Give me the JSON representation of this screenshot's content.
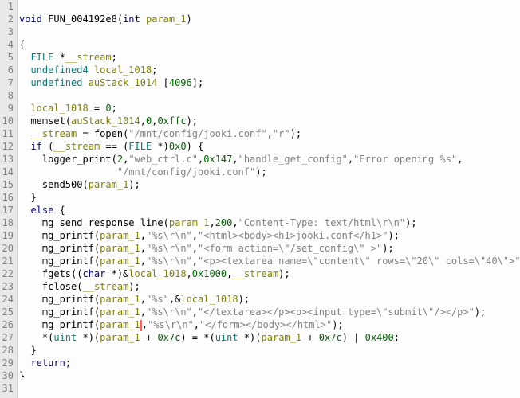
{
  "lines": [
    {
      "n": 1,
      "t": ""
    },
    {
      "n": 2,
      "t": "void FUN_004192e8(int param_1)",
      "seg": [
        {
          "c": "kw",
          "v": "void "
        },
        {
          "c": "fn",
          "v": "FUN_004192e8"
        },
        {
          "c": "",
          "v": "("
        },
        {
          "c": "kw",
          "v": "int "
        },
        {
          "c": "id",
          "v": "param_1"
        },
        {
          "c": "",
          "v": ")"
        }
      ]
    },
    {
      "n": 3,
      "t": ""
    },
    {
      "n": 4,
      "t": "{"
    },
    {
      "n": 5,
      "seg": [
        {
          "c": "",
          "v": "  "
        },
        {
          "c": "ty",
          "v": "FILE "
        },
        {
          "c": "",
          "v": "*"
        },
        {
          "c": "id",
          "v": "__stream"
        },
        {
          "c": "",
          "v": ";"
        }
      ]
    },
    {
      "n": 6,
      "seg": [
        {
          "c": "",
          "v": "  "
        },
        {
          "c": "ty",
          "v": "undefined4 "
        },
        {
          "c": "id",
          "v": "local_1018"
        },
        {
          "c": "",
          "v": ";"
        }
      ]
    },
    {
      "n": 7,
      "seg": [
        {
          "c": "",
          "v": "  "
        },
        {
          "c": "ty",
          "v": "undefined "
        },
        {
          "c": "id",
          "v": "auStack_1014 "
        },
        {
          "c": "",
          "v": "["
        },
        {
          "c": "num",
          "v": "4096"
        },
        {
          "c": "",
          "v": "];"
        }
      ]
    },
    {
      "n": 8,
      "t": "  "
    },
    {
      "n": 9,
      "seg": [
        {
          "c": "",
          "v": "  "
        },
        {
          "c": "id",
          "v": "local_1018"
        },
        {
          "c": "",
          "v": " = "
        },
        {
          "c": "num",
          "v": "0"
        },
        {
          "c": "",
          "v": ";"
        }
      ]
    },
    {
      "n": 10,
      "seg": [
        {
          "c": "",
          "v": "  "
        },
        {
          "c": "fn",
          "v": "memset"
        },
        {
          "c": "",
          "v": "("
        },
        {
          "c": "id",
          "v": "auStack_1014"
        },
        {
          "c": "",
          "v": ","
        },
        {
          "c": "num",
          "v": "0"
        },
        {
          "c": "",
          "v": ","
        },
        {
          "c": "num",
          "v": "0xffc"
        },
        {
          "c": "",
          "v": ");"
        }
      ]
    },
    {
      "n": 11,
      "seg": [
        {
          "c": "",
          "v": "  "
        },
        {
          "c": "id",
          "v": "__stream"
        },
        {
          "c": "",
          "v": " = "
        },
        {
          "c": "fn",
          "v": "fopen"
        },
        {
          "c": "",
          "v": "("
        },
        {
          "c": "str",
          "v": "\"/mnt/config/jooki.conf\""
        },
        {
          "c": "",
          "v": ","
        },
        {
          "c": "str",
          "v": "\"r\""
        },
        {
          "c": "",
          "v": ");"
        }
      ]
    },
    {
      "n": 12,
      "seg": [
        {
          "c": "",
          "v": "  "
        },
        {
          "c": "kw",
          "v": "if "
        },
        {
          "c": "",
          "v": "("
        },
        {
          "c": "id",
          "v": "__stream"
        },
        {
          "c": "",
          "v": " == ("
        },
        {
          "c": "ty",
          "v": "FILE "
        },
        {
          "c": "",
          "v": "*)"
        },
        {
          "c": "num",
          "v": "0x0"
        },
        {
          "c": "",
          "v": ") {"
        }
      ]
    },
    {
      "n": 13,
      "seg": [
        {
          "c": "",
          "v": "    "
        },
        {
          "c": "fn",
          "v": "logger_print"
        },
        {
          "c": "",
          "v": "("
        },
        {
          "c": "num",
          "v": "2"
        },
        {
          "c": "",
          "v": ","
        },
        {
          "c": "str",
          "v": "\"web_ctrl.c\""
        },
        {
          "c": "",
          "v": ","
        },
        {
          "c": "num",
          "v": "0x147"
        },
        {
          "c": "",
          "v": ","
        },
        {
          "c": "str",
          "v": "\"handle_get_config\""
        },
        {
          "c": "",
          "v": ","
        },
        {
          "c": "str",
          "v": "\"Error opening %s\""
        },
        {
          "c": "",
          "v": ","
        }
      ]
    },
    {
      "n": 14,
      "seg": [
        {
          "c": "",
          "v": "                 "
        },
        {
          "c": "str",
          "v": "\"/mnt/config/jooki.conf\""
        },
        {
          "c": "",
          "v": ");"
        }
      ]
    },
    {
      "n": 15,
      "seg": [
        {
          "c": "",
          "v": "    "
        },
        {
          "c": "fn",
          "v": "send500"
        },
        {
          "c": "",
          "v": "("
        },
        {
          "c": "id",
          "v": "param_1"
        },
        {
          "c": "",
          "v": ");"
        }
      ]
    },
    {
      "n": 16,
      "t": "  }"
    },
    {
      "n": 17,
      "seg": [
        {
          "c": "",
          "v": "  "
        },
        {
          "c": "kw",
          "v": "else "
        },
        {
          "c": "",
          "v": "{"
        }
      ]
    },
    {
      "n": 18,
      "seg": [
        {
          "c": "",
          "v": "    "
        },
        {
          "c": "fn",
          "v": "mg_send_response_line"
        },
        {
          "c": "",
          "v": "("
        },
        {
          "c": "id",
          "v": "param_1"
        },
        {
          "c": "",
          "v": ","
        },
        {
          "c": "num",
          "v": "200"
        },
        {
          "c": "",
          "v": ","
        },
        {
          "c": "str",
          "v": "\"Content-Type: text/html\\r\\n\""
        },
        {
          "c": "",
          "v": ");"
        }
      ]
    },
    {
      "n": 19,
      "seg": [
        {
          "c": "",
          "v": "    "
        },
        {
          "c": "fn",
          "v": "mg_printf"
        },
        {
          "c": "",
          "v": "("
        },
        {
          "c": "id",
          "v": "param_1"
        },
        {
          "c": "",
          "v": ","
        },
        {
          "c": "str",
          "v": "\"%s\\r\\n\""
        },
        {
          "c": "",
          "v": ","
        },
        {
          "c": "str",
          "v": "\"<html><body><h1>jooki.conf</h1>\""
        },
        {
          "c": "",
          "v": ");"
        }
      ]
    },
    {
      "n": 20,
      "seg": [
        {
          "c": "",
          "v": "    "
        },
        {
          "c": "fn",
          "v": "mg_printf"
        },
        {
          "c": "",
          "v": "("
        },
        {
          "c": "id",
          "v": "param_1"
        },
        {
          "c": "",
          "v": ","
        },
        {
          "c": "str",
          "v": "\"%s\\r\\n\""
        },
        {
          "c": "",
          "v": ","
        },
        {
          "c": "str",
          "v": "\"<form action=\\\"/set_config\\\" >\""
        },
        {
          "c": "",
          "v": ");"
        }
      ]
    },
    {
      "n": 21,
      "seg": [
        {
          "c": "",
          "v": "    "
        },
        {
          "c": "fn",
          "v": "mg_printf"
        },
        {
          "c": "",
          "v": "("
        },
        {
          "c": "id",
          "v": "param_1"
        },
        {
          "c": "",
          "v": ","
        },
        {
          "c": "str",
          "v": "\"%s\\r\\n\""
        },
        {
          "c": "",
          "v": ","
        },
        {
          "c": "str",
          "v": "\"<p><textarea name=\\\"content\\\" rows=\\\"20\\\" cols=\\\"40\\\">\""
        },
        {
          "c": "",
          "v": ");"
        }
      ]
    },
    {
      "n": 22,
      "seg": [
        {
          "c": "",
          "v": "    "
        },
        {
          "c": "fn",
          "v": "fgets"
        },
        {
          "c": "",
          "v": "(("
        },
        {
          "c": "kw",
          "v": "char "
        },
        {
          "c": "",
          "v": "*)&"
        },
        {
          "c": "id",
          "v": "local_1018"
        },
        {
          "c": "",
          "v": ","
        },
        {
          "c": "num",
          "v": "0x1000"
        },
        {
          "c": "",
          "v": ","
        },
        {
          "c": "id",
          "v": "__stream"
        },
        {
          "c": "",
          "v": ");"
        }
      ]
    },
    {
      "n": 23,
      "seg": [
        {
          "c": "",
          "v": "    "
        },
        {
          "c": "fn",
          "v": "fclose"
        },
        {
          "c": "",
          "v": "("
        },
        {
          "c": "id",
          "v": "__stream"
        },
        {
          "c": "",
          "v": ");"
        }
      ]
    },
    {
      "n": 24,
      "seg": [
        {
          "c": "",
          "v": "    "
        },
        {
          "c": "fn",
          "v": "mg_printf"
        },
        {
          "c": "",
          "v": "("
        },
        {
          "c": "id",
          "v": "param_1"
        },
        {
          "c": "",
          "v": ","
        },
        {
          "c": "str",
          "v": "\"%s\""
        },
        {
          "c": "",
          "v": ",&"
        },
        {
          "c": "id",
          "v": "local_1018"
        },
        {
          "c": "",
          "v": ");"
        }
      ]
    },
    {
      "n": 25,
      "seg": [
        {
          "c": "",
          "v": "    "
        },
        {
          "c": "fn",
          "v": "mg_printf"
        },
        {
          "c": "",
          "v": "("
        },
        {
          "c": "id",
          "v": "param_1"
        },
        {
          "c": "",
          "v": ","
        },
        {
          "c": "str",
          "v": "\"%s\\r\\n\""
        },
        {
          "c": "",
          "v": ","
        },
        {
          "c": "str",
          "v": "\"</textarea></p><p><input type=\\\"submit\\\"/></p>\""
        },
        {
          "c": "",
          "v": ");"
        }
      ]
    },
    {
      "n": 26,
      "seg": [
        {
          "c": "",
          "v": "    "
        },
        {
          "c": "fn",
          "v": "mg_printf"
        },
        {
          "c": "",
          "v": "("
        },
        {
          "c": "id",
          "v": "param_1"
        },
        {
          "c": "cursor",
          "v": ""
        },
        {
          "c": "",
          "v": ","
        },
        {
          "c": "str",
          "v": "\"%s\\r\\n\""
        },
        {
          "c": "",
          "v": ","
        },
        {
          "c": "str",
          "v": "\"</form></body></html>\""
        },
        {
          "c": "",
          "v": ");"
        }
      ]
    },
    {
      "n": 27,
      "seg": [
        {
          "c": "",
          "v": "    *("
        },
        {
          "c": "ty",
          "v": "uint "
        },
        {
          "c": "",
          "v": "*)("
        },
        {
          "c": "id",
          "v": "param_1"
        },
        {
          "c": "",
          "v": " + "
        },
        {
          "c": "num",
          "v": "0x7c"
        },
        {
          "c": "",
          "v": ") = *("
        },
        {
          "c": "ty",
          "v": "uint "
        },
        {
          "c": "",
          "v": "*)("
        },
        {
          "c": "id",
          "v": "param_1"
        },
        {
          "c": "",
          "v": " + "
        },
        {
          "c": "num",
          "v": "0x7c"
        },
        {
          "c": "",
          "v": ") | "
        },
        {
          "c": "num",
          "v": "0x400"
        },
        {
          "c": "",
          "v": ";"
        }
      ]
    },
    {
      "n": 28,
      "t": "  }"
    },
    {
      "n": 29,
      "seg": [
        {
          "c": "",
          "v": "  "
        },
        {
          "c": "kw",
          "v": "return"
        },
        {
          "c": "",
          "v": ";"
        }
      ]
    },
    {
      "n": 30,
      "t": "}"
    },
    {
      "n": 31,
      "t": ""
    }
  ]
}
